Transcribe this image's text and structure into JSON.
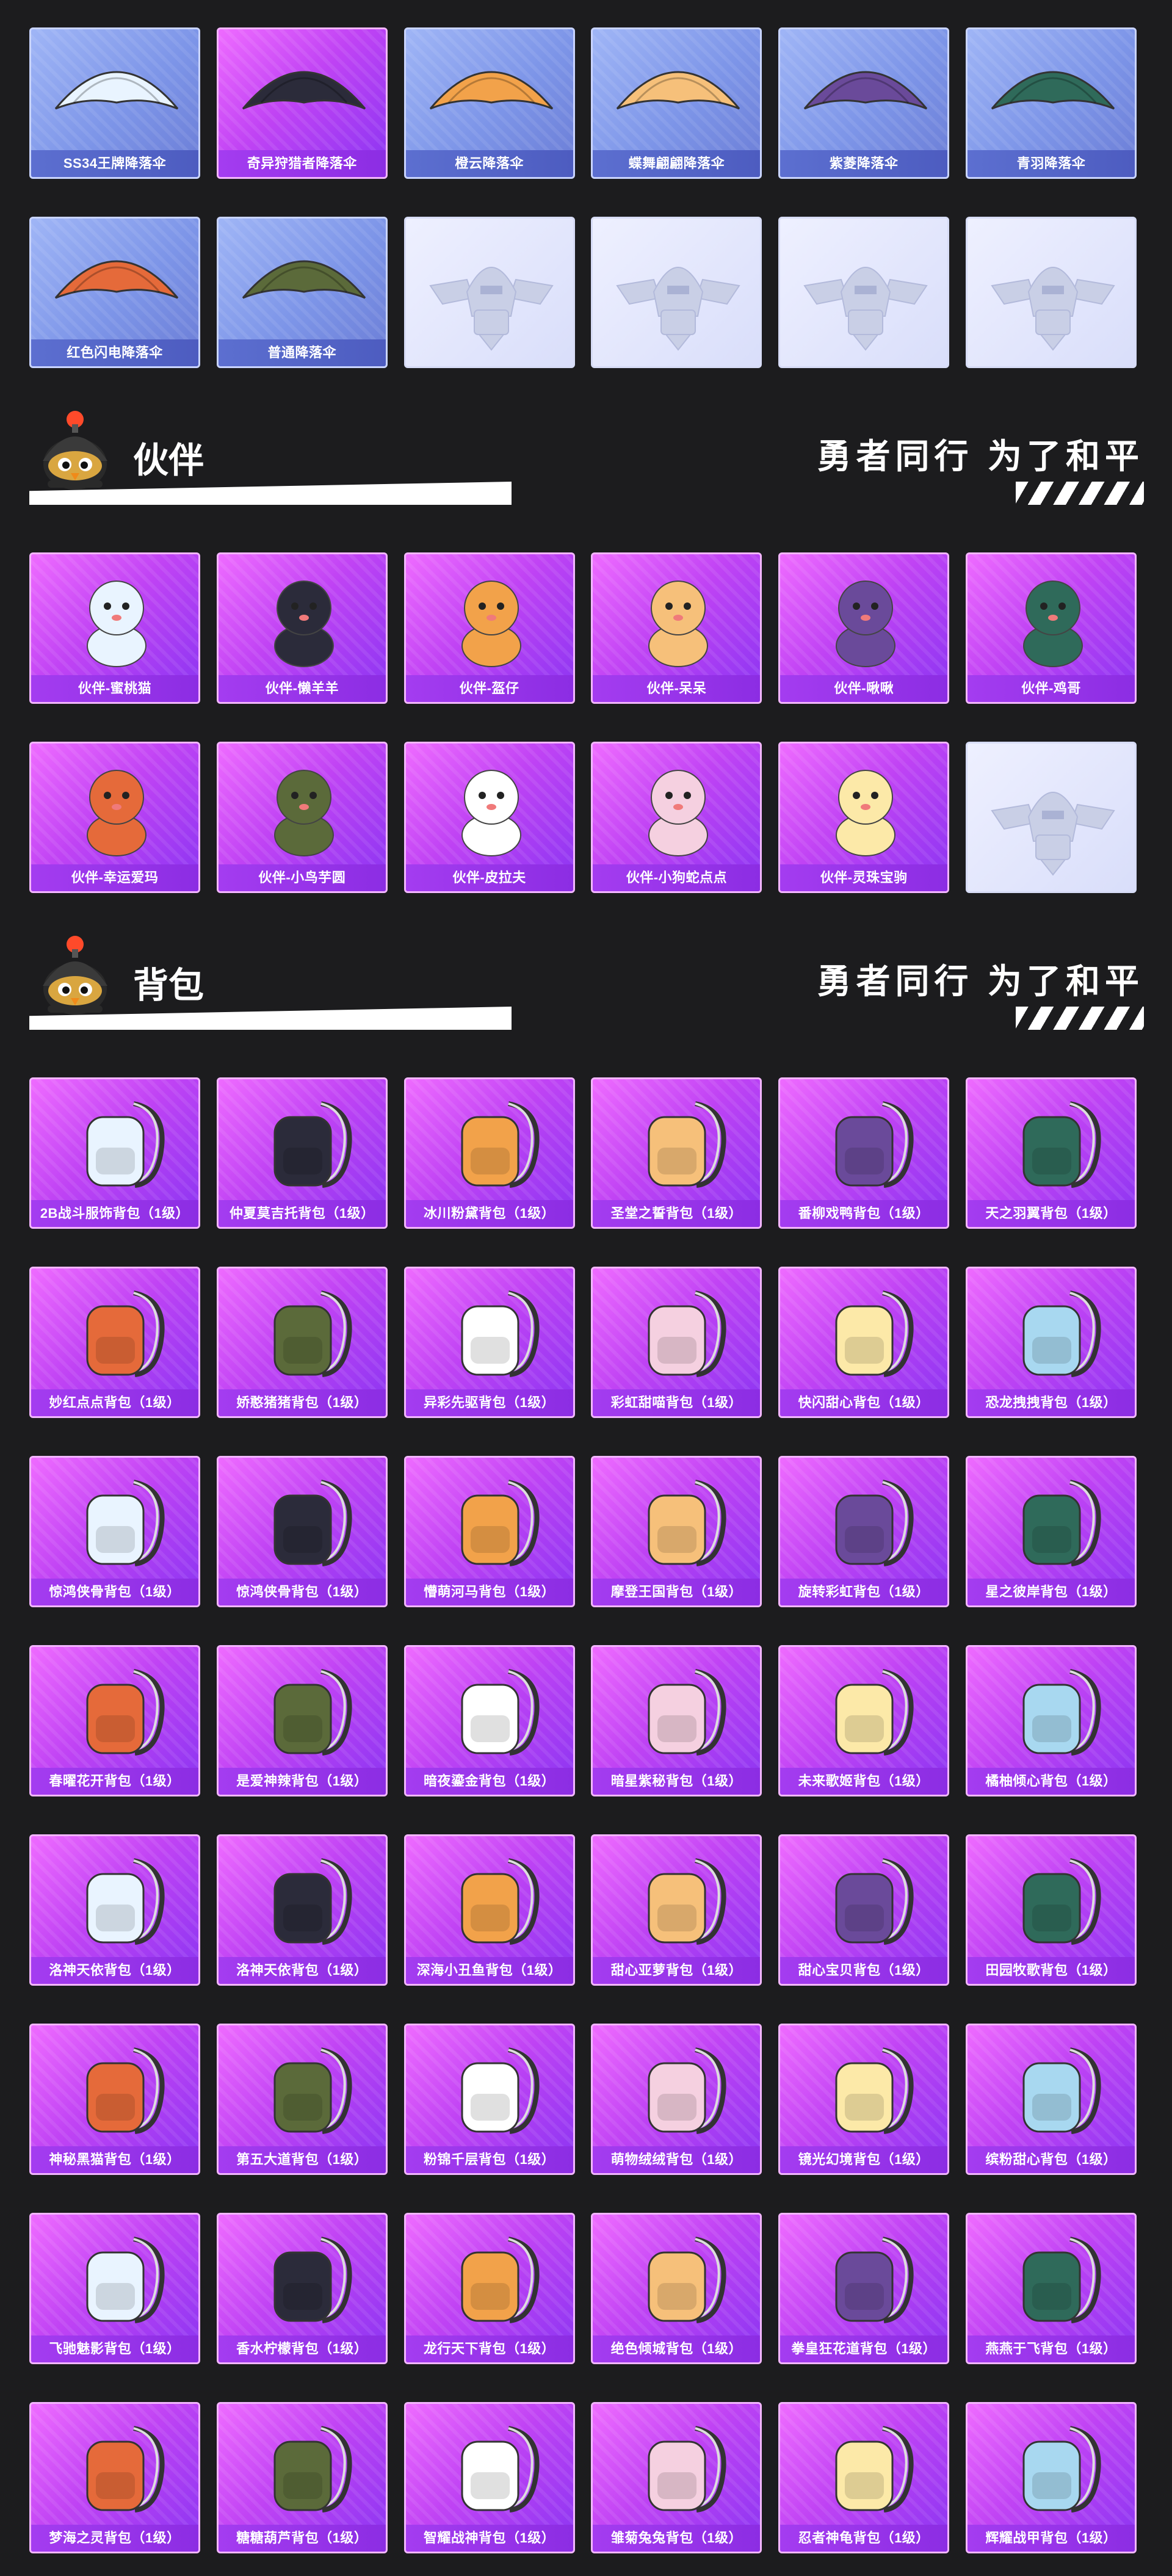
{
  "colors": {
    "background": "#1c1c1e",
    "card_purple": "#c043f4",
    "card_blue": "#7d95e8",
    "card_empty": "#e4e8fc",
    "label_purple": "#9a35ea",
    "label_blue": "#5565c8"
  },
  "parachutes": {
    "items": [
      {
        "label": "SS34王牌降落伞",
        "style": "blue",
        "icon": "parachute-icon"
      },
      {
        "label": "奇异狩猎者降落伞",
        "style": "purple",
        "icon": "parachute-icon"
      },
      {
        "label": "橙云降落伞",
        "style": "blue",
        "icon": "parachute-icon"
      },
      {
        "label": "蝶舞翩翩降落伞",
        "style": "blue",
        "icon": "parachute-icon"
      },
      {
        "label": "紫菱降落伞",
        "style": "blue",
        "icon": "parachute-icon"
      },
      {
        "label": "青羽降落伞",
        "style": "blue",
        "icon": "parachute-icon"
      },
      {
        "label": "红色闪电降落伞",
        "style": "blue",
        "icon": "parachute-icon"
      },
      {
        "label": "普通降落伞",
        "style": "blue",
        "icon": "parachute-icon"
      },
      {
        "label": "",
        "style": "empty",
        "icon": "placeholder-emblem-icon"
      },
      {
        "label": "",
        "style": "empty",
        "icon": "placeholder-emblem-icon"
      },
      {
        "label": "",
        "style": "empty",
        "icon": "placeholder-emblem-icon"
      },
      {
        "label": "",
        "style": "empty",
        "icon": "placeholder-emblem-icon"
      }
    ]
  },
  "companions": {
    "title": "伙伴",
    "slogan": "勇者同行 为了和平",
    "items": [
      {
        "label": "伙伴-蜜桃猫",
        "style": "purple",
        "icon": "companion-icon"
      },
      {
        "label": "伙伴-懒羊羊",
        "style": "purple",
        "icon": "companion-icon"
      },
      {
        "label": "伙伴-盔仔",
        "style": "purple",
        "icon": "companion-icon"
      },
      {
        "label": "伙伴-呆呆",
        "style": "purple",
        "icon": "companion-icon"
      },
      {
        "label": "伙伴-啾啾",
        "style": "purple",
        "icon": "companion-icon"
      },
      {
        "label": "伙伴-鸡哥",
        "style": "purple",
        "icon": "companion-icon"
      },
      {
        "label": "伙伴-幸运爱玛",
        "style": "purple",
        "icon": "companion-icon"
      },
      {
        "label": "伙伴-小鸟芋圆",
        "style": "purple",
        "icon": "companion-icon"
      },
      {
        "label": "伙伴-皮拉夫",
        "style": "purple",
        "icon": "companion-icon"
      },
      {
        "label": "伙伴-小狗蛇点点",
        "style": "purple",
        "icon": "companion-icon"
      },
      {
        "label": "伙伴-灵珠宝驹",
        "style": "purple",
        "icon": "companion-icon"
      },
      {
        "label": "",
        "style": "empty",
        "icon": "placeholder-emblem-icon"
      }
    ]
  },
  "backpacks": {
    "title": "背包",
    "slogan": "勇者同行 为了和平",
    "items": [
      {
        "label": "2B战斗服饰背包（1级）",
        "style": "purple",
        "icon": "backpack-icon"
      },
      {
        "label": "仲夏莫吉托背包（1级）",
        "style": "purple",
        "icon": "backpack-icon"
      },
      {
        "label": "冰川粉黛背包（1级）",
        "style": "purple",
        "icon": "backpack-icon"
      },
      {
        "label": "圣堂之誓背包（1级）",
        "style": "purple",
        "icon": "backpack-icon"
      },
      {
        "label": "番柳戏鸭背包（1级）",
        "style": "purple",
        "icon": "backpack-icon"
      },
      {
        "label": "天之羽翼背包（1级）",
        "style": "purple",
        "icon": "backpack-icon"
      },
      {
        "label": "妙红点点背包（1级）",
        "style": "purple",
        "icon": "backpack-icon"
      },
      {
        "label": "娇憨猪猪背包（1级）",
        "style": "purple",
        "icon": "backpack-icon"
      },
      {
        "label": "异彩先驱背包（1级）",
        "style": "purple",
        "icon": "backpack-icon"
      },
      {
        "label": "彩虹甜喵背包（1级）",
        "style": "purple",
        "icon": "backpack-icon"
      },
      {
        "label": "快闪甜心背包（1级）",
        "style": "purple",
        "icon": "backpack-icon"
      },
      {
        "label": "恐龙拽拽背包（1级）",
        "style": "purple",
        "icon": "backpack-icon"
      },
      {
        "label": "惊鸿侠骨背包（1级）",
        "style": "purple",
        "icon": "backpack-icon"
      },
      {
        "label": "惊鸿侠骨背包（1级）",
        "style": "purple",
        "icon": "backpack-icon"
      },
      {
        "label": "懵萌河马背包（1级）",
        "style": "purple",
        "icon": "backpack-icon"
      },
      {
        "label": "摩登王国背包（1级）",
        "style": "purple",
        "icon": "backpack-icon"
      },
      {
        "label": "旋转彩虹背包（1级）",
        "style": "purple",
        "icon": "backpack-icon"
      },
      {
        "label": "星之彼岸背包（1级）",
        "style": "purple",
        "icon": "backpack-icon"
      },
      {
        "label": "春曜花开背包（1级）",
        "style": "purple",
        "icon": "backpack-icon"
      },
      {
        "label": "是爱神辣背包（1级）",
        "style": "purple",
        "icon": "backpack-icon"
      },
      {
        "label": "暗夜鎏金背包（1级）",
        "style": "purple",
        "icon": "backpack-icon"
      },
      {
        "label": "暗星紫秘背包（1级）",
        "style": "purple",
        "icon": "backpack-icon"
      },
      {
        "label": "未来歌姬背包（1级）",
        "style": "purple",
        "icon": "backpack-icon"
      },
      {
        "label": "橘柚倾心背包（1级）",
        "style": "purple",
        "icon": "backpack-icon"
      },
      {
        "label": "洛神天依背包（1级）",
        "style": "purple",
        "icon": "backpack-icon"
      },
      {
        "label": "洛神天依背包（1级）",
        "style": "purple",
        "icon": "backpack-icon"
      },
      {
        "label": "深海小丑鱼背包（1级）",
        "style": "purple",
        "icon": "backpack-icon"
      },
      {
        "label": "甜心亚萝背包（1级）",
        "style": "purple",
        "icon": "backpack-icon"
      },
      {
        "label": "甜心宝贝背包（1级）",
        "style": "purple",
        "icon": "backpack-icon"
      },
      {
        "label": "田园牧歌背包（1级）",
        "style": "purple",
        "icon": "backpack-icon"
      },
      {
        "label": "神秘黑猫背包（1级）",
        "style": "purple",
        "icon": "backpack-icon"
      },
      {
        "label": "第五大道背包（1级）",
        "style": "purple",
        "icon": "backpack-icon"
      },
      {
        "label": "粉锦千层背包（1级）",
        "style": "purple",
        "icon": "backpack-icon"
      },
      {
        "label": "萌物绒绒背包（1级）",
        "style": "purple",
        "icon": "backpack-icon"
      },
      {
        "label": "镜光幻境背包（1级）",
        "style": "purple",
        "icon": "backpack-icon"
      },
      {
        "label": "缤粉甜心背包（1级）",
        "style": "purple",
        "icon": "backpack-icon"
      },
      {
        "label": "飞驰魅影背包（1级）",
        "style": "purple",
        "icon": "backpack-icon"
      },
      {
        "label": "香水柠檬背包（1级）",
        "style": "purple",
        "icon": "backpack-icon"
      },
      {
        "label": "龙行天下背包（1级）",
        "style": "purple",
        "icon": "backpack-icon"
      },
      {
        "label": "绝色倾城背包（1级）",
        "style": "purple",
        "icon": "backpack-icon"
      },
      {
        "label": "拳皇狂花道背包（1级）",
        "style": "purple",
        "icon": "backpack-icon"
      },
      {
        "label": "燕燕于飞背包（1级）",
        "style": "purple",
        "icon": "backpack-icon"
      },
      {
        "label": "梦海之灵背包（1级）",
        "style": "purple",
        "icon": "backpack-icon"
      },
      {
        "label": "糖糖葫芦背包（1级）",
        "style": "purple",
        "icon": "backpack-icon"
      },
      {
        "label": "智耀战神背包（1级）",
        "style": "purple",
        "icon": "backpack-icon"
      },
      {
        "label": "雏菊兔兔背包（1级）",
        "style": "purple",
        "icon": "backpack-icon"
      },
      {
        "label": "忍者神龟背包（1级）",
        "style": "purple",
        "icon": "backpack-icon"
      },
      {
        "label": "辉耀战甲背包（1级）",
        "style": "purple",
        "icon": "backpack-icon"
      }
    ]
  }
}
